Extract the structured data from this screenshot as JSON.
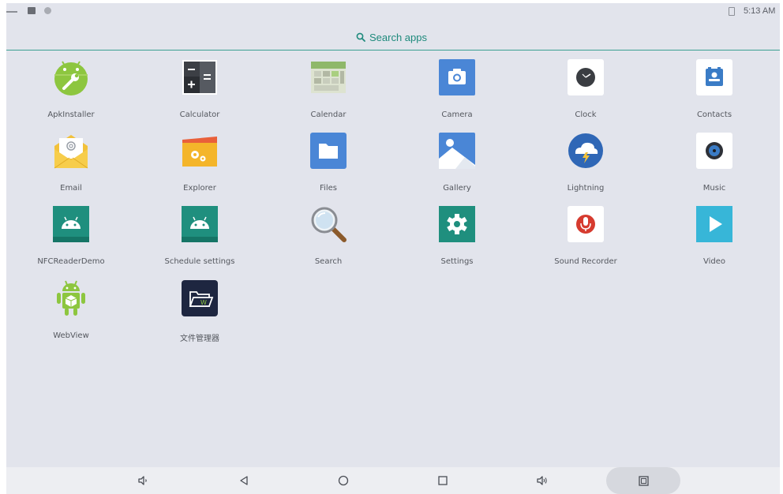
{
  "status_bar": {
    "time": "5:13 AM"
  },
  "search": {
    "label": "Search apps"
  },
  "apps": [
    {
      "label": "ApkInstaller",
      "icon": "android-wrench-icon"
    },
    {
      "label": "Calculator",
      "icon": "calculator-icon"
    },
    {
      "label": "Calendar",
      "icon": "calendar-icon"
    },
    {
      "label": "Camera",
      "icon": "camera-icon"
    },
    {
      "label": "Clock",
      "icon": "clock-icon"
    },
    {
      "label": "Contacts",
      "icon": "contacts-icon"
    },
    {
      "label": "Email",
      "icon": "email-icon"
    },
    {
      "label": "Explorer",
      "icon": "explorer-icon"
    },
    {
      "label": "Files",
      "icon": "files-icon"
    },
    {
      "label": "Gallery",
      "icon": "gallery-icon"
    },
    {
      "label": "Lightning",
      "icon": "lightning-icon"
    },
    {
      "label": "Music",
      "icon": "music-icon"
    },
    {
      "label": "NFCReaderDemo",
      "icon": "android-icon"
    },
    {
      "label": "Schedule settings",
      "icon": "android-icon"
    },
    {
      "label": "Search",
      "icon": "magnifier-icon"
    },
    {
      "label": "Settings",
      "icon": "settings-gear-icon"
    },
    {
      "label": "Sound Recorder",
      "icon": "microphone-icon"
    },
    {
      "label": "Video",
      "icon": "play-icon"
    },
    {
      "label": "WebView",
      "icon": "android-cube-icon"
    },
    {
      "label": "文件管理器",
      "icon": "file-manager-icon"
    }
  ],
  "nav_bar": {
    "buttons": [
      "volume-down-icon",
      "back-icon",
      "home-icon",
      "recents-icon",
      "volume-up-icon",
      "screenshot-icon"
    ]
  },
  "colors": {
    "background": "#e2e4ec",
    "accent": "#1e8a7c",
    "nav_background": "#edeef2"
  }
}
